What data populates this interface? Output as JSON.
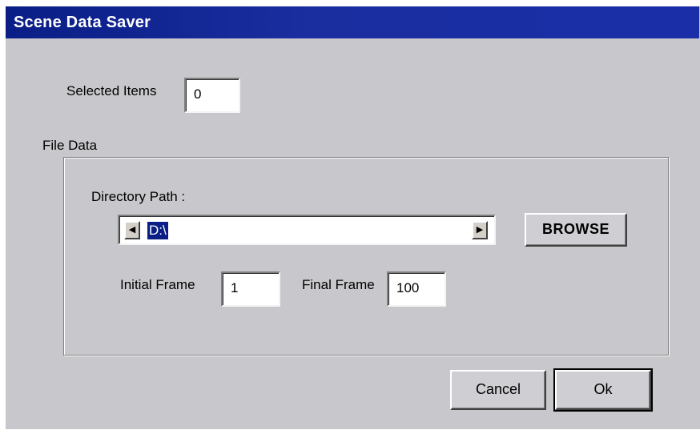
{
  "window": {
    "title": "Scene Data Saver"
  },
  "selected_items": {
    "label": "Selected Items",
    "value": "0"
  },
  "file_data": {
    "group_label": "File Data",
    "directory_label": "Directory Path :",
    "directory_value": "D:\\",
    "left_arrow": "◀",
    "right_arrow": "▶",
    "browse_label": "BROWSE",
    "initial_frame_label": "Initial Frame",
    "initial_frame_value": "1",
    "final_frame_label": "Final Frame",
    "final_frame_value": "100"
  },
  "buttons": {
    "cancel_label": "Cancel",
    "ok_label": "Ok"
  }
}
